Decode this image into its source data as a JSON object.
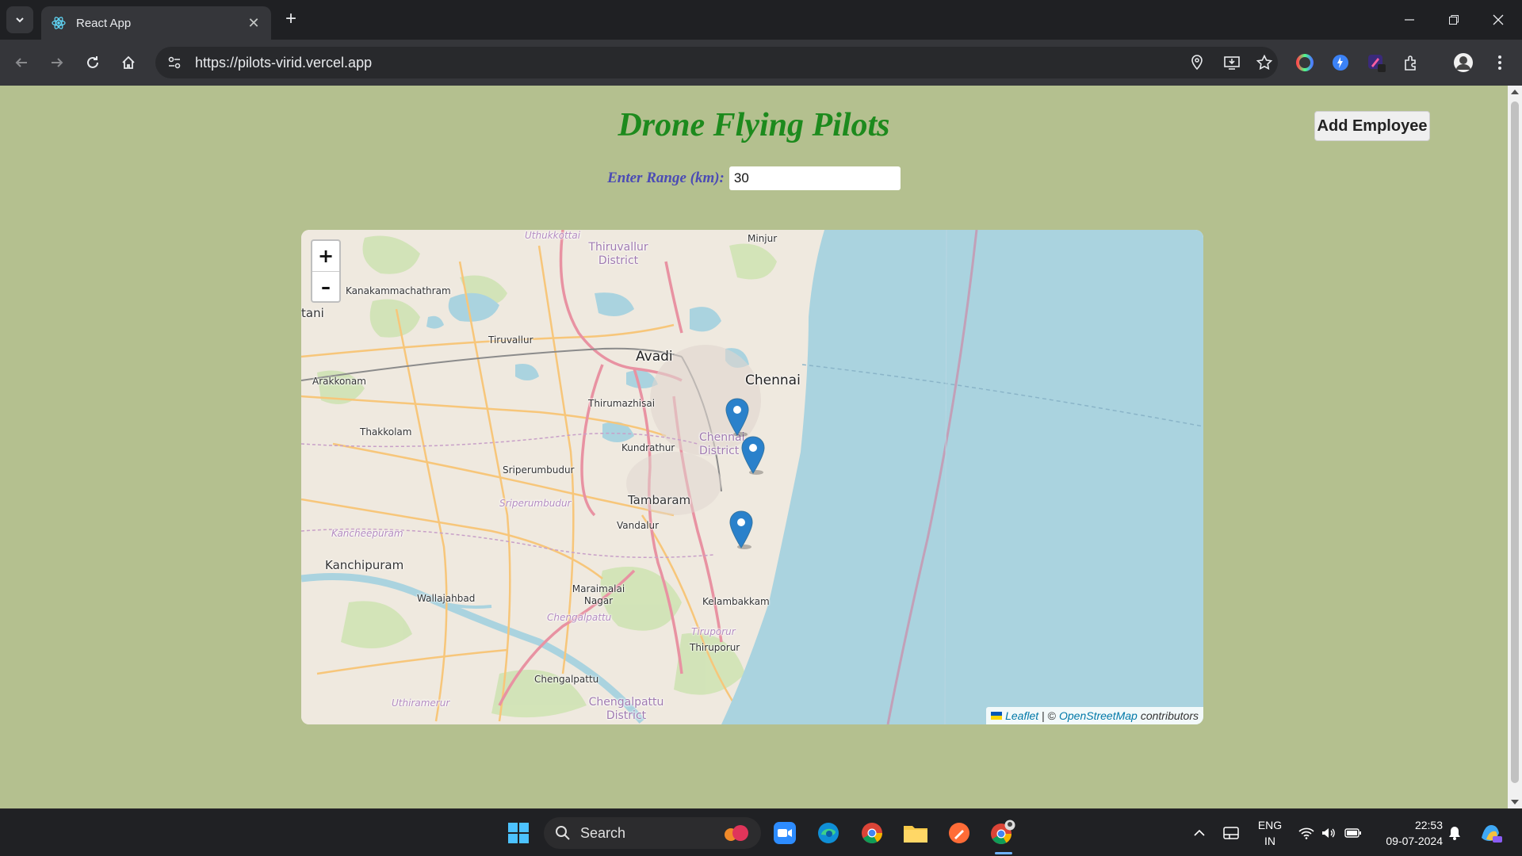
{
  "browser": {
    "tab_title": "React App",
    "url": "https://pilots-virid.vercel.app"
  },
  "page": {
    "title": "Drone Flying Pilots",
    "add_button": "Add Employee",
    "range_label": "Enter Range (km):",
    "range_value": "30"
  },
  "map": {
    "zoom_in": "+",
    "zoom_out": "–",
    "places": {
      "uthukkottai": "Uthukkottai",
      "thiruvallur_district": "Thiruvallur District",
      "minjur": "Minjur",
      "kanakammachathram": "Kanakammachathram",
      "tani": "tani",
      "tiruvallur": "Tiruvallur",
      "avadi": "Avadi",
      "chennai": "Chennai",
      "arakkonam": "Arakkonam",
      "thirumazhisai": "Thirumazhisai",
      "thakkolam": "Thakkolam",
      "chennai_district": "Chennai District",
      "kundrathur": "Kundrathur",
      "sriperumbudur": "Sriperumbudur",
      "sriperumbudur_taluk": "Sriperumbudur",
      "tambaram": "Tambaram",
      "vandalur": "Vandalur",
      "kancheepuram_taluk": "Kancheepuram",
      "kanchipuram": "Kanchipuram",
      "maraimalai_nagar": "Maraimalai Nagar",
      "wallajahbad": "Wallajahbad",
      "chengalpattu_taluk": "Chengalpattu",
      "kelambakkam": "Kelambakkam",
      "tiruporur_taluk": "Tiruporur",
      "thiruporur": "Thiruporur",
      "chengalpattu": "Chengalpattu",
      "uthiramerur": "Uthiramerur",
      "chengalpattu_district": "Chengalpattu District"
    },
    "markers_count": 3,
    "attribution": {
      "leaflet": "Leaflet",
      "separator": "| ©",
      "osm": "OpenStreetMap",
      "contributors": "contributors"
    },
    "colors": {
      "sea": "#aad3df",
      "land": "#efe9df",
      "marker": "#2a81cb"
    }
  },
  "taskbar": {
    "search_label": "Search",
    "lang_top": "ENG",
    "lang_bottom": "IN",
    "time": "22:53",
    "date": "09-07-2024"
  },
  "colors": {
    "page_bg": "#b4c08f",
    "title": "#1d8a1d",
    "range_label": "#4b4bb5"
  }
}
